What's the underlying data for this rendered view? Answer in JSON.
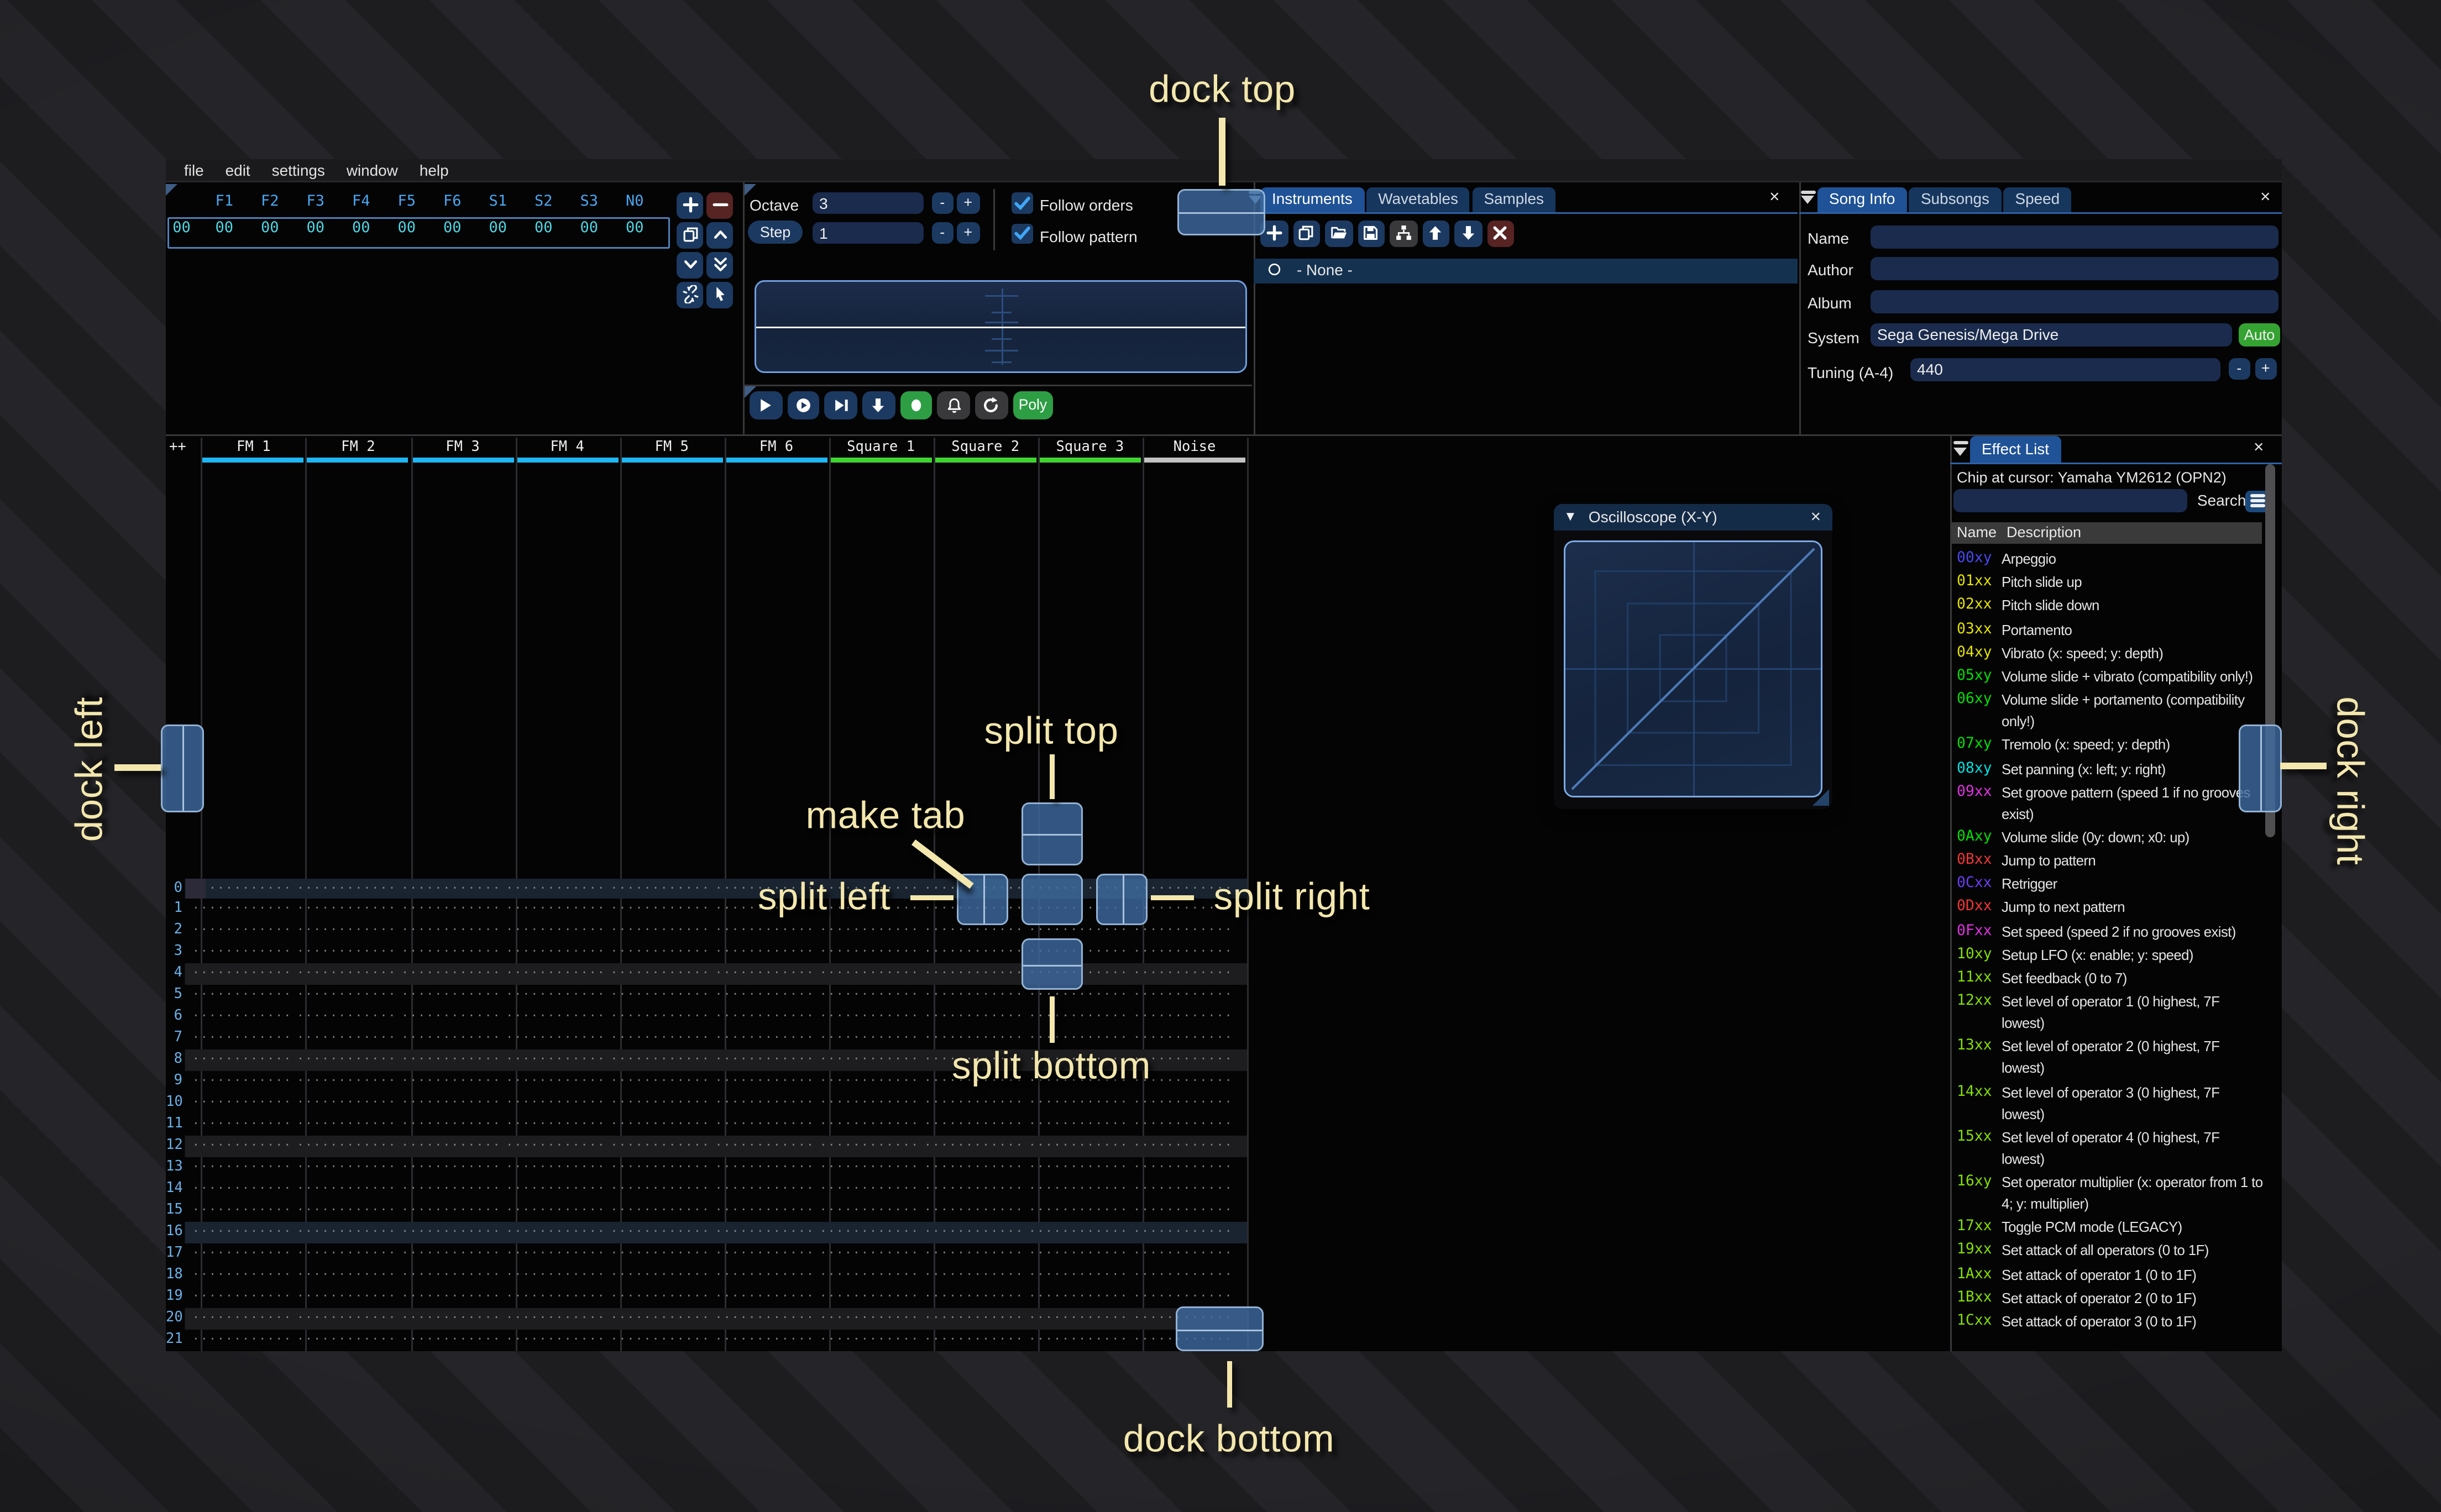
{
  "menu": {
    "items": [
      "file",
      "edit",
      "settings",
      "window",
      "help"
    ]
  },
  "orders": {
    "row_index": "00",
    "channels": [
      "F1",
      "F2",
      "F3",
      "F4",
      "F5",
      "F6",
      "S1",
      "S2",
      "S3",
      "N0"
    ],
    "row_values": [
      "00",
      "00",
      "00",
      "00",
      "00",
      "00",
      "00",
      "00",
      "00",
      "00"
    ],
    "buttons": [
      {
        "name": "add-order-button",
        "icon": "plus-icon",
        "variant": "blue"
      },
      {
        "name": "remove-order-button",
        "icon": "minus-icon",
        "variant": "red"
      },
      {
        "name": "duplicate-order-button",
        "icon": "duplicate-icon",
        "variant": "blue"
      },
      {
        "name": "move-order-up-button",
        "icon": "chevron-up-icon",
        "variant": "blue"
      },
      {
        "name": "move-order-down-button",
        "icon": "chevron-down-icon",
        "variant": "blue"
      },
      {
        "name": "duplicate-order-end-button",
        "icon": "double-chevron-down-icon",
        "variant": "blue"
      },
      {
        "name": "order-change-mode-button",
        "icon": "broken-link-icon",
        "variant": "blue"
      },
      {
        "name": "order-edit-mode-button",
        "icon": "pointer-icon",
        "variant": "blue"
      }
    ]
  },
  "play_controls": {
    "octave_label": "Octave",
    "octave_value": "3",
    "step_label": "Step",
    "step_value": "1",
    "decrement_label": "-",
    "increment_label": "+",
    "follow_orders": {
      "label": "Follow orders",
      "checked": true
    },
    "follow_pattern": {
      "label": "Follow pattern",
      "checked": true
    },
    "transport": [
      {
        "name": "play-button",
        "icon": "play-icon",
        "variant": "blue"
      },
      {
        "name": "play-pattern-button",
        "icon": "play-circle-icon",
        "variant": "blue"
      },
      {
        "name": "play-row-button",
        "icon": "play-row-icon",
        "variant": "blue"
      },
      {
        "name": "step-row-button",
        "icon": "arrow-down-icon",
        "variant": "blue"
      },
      {
        "name": "edit-record-button",
        "icon": "record-icon",
        "variant": "green"
      },
      {
        "name": "metronome-button",
        "icon": "bell-icon",
        "variant": "gray"
      },
      {
        "name": "repeat-pattern-button",
        "icon": "repeat-icon",
        "variant": "gray"
      },
      {
        "name": "poly-button",
        "label": "Poly",
        "variant": "green poly"
      }
    ]
  },
  "instruments_panel": {
    "tabs": [
      "Instruments",
      "Wavetables",
      "Samples"
    ],
    "active_tab": "Instruments",
    "close_label": "×",
    "toolbar": [
      {
        "name": "add-instrument-button",
        "icon": "plus-icon",
        "variant": "blue"
      },
      {
        "name": "duplicate-instrument-button",
        "icon": "duplicate-icon",
        "variant": "blue"
      },
      {
        "name": "open-instrument-button",
        "icon": "folder-open-icon",
        "variant": "blue"
      },
      {
        "name": "save-instrument-button",
        "icon": "floppy-icon",
        "variant": "blue"
      },
      {
        "name": "instrument-folders-button",
        "icon": "tree-icon",
        "variant": "gray"
      },
      {
        "name": "move-instrument-up-button",
        "icon": "arrow-up-icon",
        "variant": "blue"
      },
      {
        "name": "move-instrument-down-button",
        "icon": "arrow-down-icon",
        "variant": "blue"
      },
      {
        "name": "delete-instrument-button",
        "icon": "delete-x-icon",
        "variant": "red"
      }
    ],
    "list": [
      {
        "icon": "circle-icon",
        "label": "- None -",
        "selected": true
      }
    ]
  },
  "song_info_panel": {
    "tabs": [
      "Song Info",
      "Subsongs",
      "Speed"
    ],
    "active_tab": "Song Info",
    "close_label": "×",
    "fields": [
      {
        "label": "Name",
        "value": ""
      },
      {
        "label": "Author",
        "value": ""
      },
      {
        "label": "Album",
        "value": ""
      }
    ],
    "system_label": "System",
    "system_value": "Sega Genesis/Mega Drive",
    "auto_label": "Auto",
    "tuning_label": "Tuning (A-4)",
    "tuning_value": "440",
    "decrement_label": "-",
    "increment_label": "+"
  },
  "pattern": {
    "corner_label": "++",
    "channels": [
      {
        "name": "FM 1",
        "underline_color": "#1fb6f3"
      },
      {
        "name": "FM 2",
        "underline_color": "#1fb6f3"
      },
      {
        "name": "FM 3",
        "underline_color": "#1fb6f3"
      },
      {
        "name": "FM 4",
        "underline_color": "#1fb6f3"
      },
      {
        "name": "FM 5",
        "underline_color": "#1fb6f3"
      },
      {
        "name": "FM 6",
        "underline_color": "#1fb6f3"
      },
      {
        "name": "Square 1",
        "underline_color": "#3fd430"
      },
      {
        "name": "Square 2",
        "underline_color": "#3fd430"
      },
      {
        "name": "Square 3",
        "underline_color": "#3fd430"
      },
      {
        "name": "Noise",
        "underline_color": "#c2c2c2"
      }
    ],
    "row_labels": [
      "0",
      "1",
      "2",
      "3",
      "4",
      "5",
      "6",
      "7",
      "8",
      "9",
      "10",
      "11",
      "12",
      "13",
      "14",
      "15",
      "16",
      "17",
      "18",
      "19",
      "20",
      "21"
    ],
    "empty_cell": "·············",
    "cursor": {
      "row": 0,
      "channel": "FM 1"
    }
  },
  "effect_list_panel": {
    "title": "Effect List",
    "close_label": "×",
    "chip_at_cursor": "Chip at cursor: Yamaha YM2612 (OPN2)",
    "search_value": "",
    "search_label": "Search",
    "columns": [
      "Name",
      "Description"
    ],
    "rows": [
      {
        "code": "00xy",
        "color": "#4848f0",
        "desc": "Arpeggio"
      },
      {
        "code": "01xx",
        "color": "#e3e300",
        "desc": "Pitch slide up"
      },
      {
        "code": "02xx",
        "color": "#e3e300",
        "desc": "Pitch slide down"
      },
      {
        "code": "03xx",
        "color": "#e3e300",
        "desc": "Portamento"
      },
      {
        "code": "04xy",
        "color": "#e3e300",
        "desc": "Vibrato (x: speed; y: depth)"
      },
      {
        "code": "05xy",
        "color": "#00e000",
        "desc": "Volume slide + vibrato (compatibility only!)"
      },
      {
        "code": "06xy",
        "color": "#00e000",
        "desc": "Volume slide + portamento (compatibility only!)"
      },
      {
        "code": "07xy",
        "color": "#00e000",
        "desc": "Tremolo (x: speed; y: depth)"
      },
      {
        "code": "08xy",
        "color": "#00e2e2",
        "desc": "Set panning (x: left; y: right)"
      },
      {
        "code": "09xx",
        "color": "#e032e0",
        "desc": "Set groove pattern (speed 1 if no grooves exist)"
      },
      {
        "code": "0Axy",
        "color": "#00e000",
        "desc": "Volume slide (0y: down; x0: up)"
      },
      {
        "code": "0Bxx",
        "color": "#f23535",
        "desc": "Jump to pattern"
      },
      {
        "code": "0Cxx",
        "color": "#6a3df2",
        "desc": "Retrigger"
      },
      {
        "code": "0Dxx",
        "color": "#f23535",
        "desc": "Jump to next pattern"
      },
      {
        "code": "0Fxx",
        "color": "#e032e0",
        "desc": "Set speed (speed 2 if no grooves exist)"
      },
      {
        "code": "10xy",
        "color": "#84e000",
        "desc": "Setup LFO (x: enable; y: speed)"
      },
      {
        "code": "11xx",
        "color": "#84e000",
        "desc": "Set feedback (0 to 7)"
      },
      {
        "code": "12xx",
        "color": "#84e000",
        "desc": "Set level of operator 1 (0 highest, 7F lowest)"
      },
      {
        "code": "13xx",
        "color": "#84e000",
        "desc": "Set level of operator 2 (0 highest, 7F lowest)"
      },
      {
        "code": "14xx",
        "color": "#84e000",
        "desc": "Set level of operator 3 (0 highest, 7F lowest)"
      },
      {
        "code": "15xx",
        "color": "#84e000",
        "desc": "Set level of operator 4 (0 highest, 7F lowest)"
      },
      {
        "code": "16xy",
        "color": "#84e000",
        "desc": "Set operator multiplier (x: operator from 1 to 4; y: multiplier)"
      },
      {
        "code": "17xx",
        "color": "#84e000",
        "desc": "Toggle PCM mode (LEGACY)"
      },
      {
        "code": "19xx",
        "color": "#84e000",
        "desc": "Set attack of all operators (0 to 1F)"
      },
      {
        "code": "1Axx",
        "color": "#84e000",
        "desc": "Set attack of operator 1 (0 to 1F)"
      },
      {
        "code": "1Bxx",
        "color": "#84e000",
        "desc": "Set attack of operator 2 (0 to 1F)"
      },
      {
        "code": "1Cxx",
        "color": "#84e000",
        "desc": "Set attack of operator 3 (0 to 1F)"
      }
    ]
  },
  "oscilloscope_window": {
    "title": "Oscilloscope (X-Y)",
    "close_label": "×",
    "collapse_icon": "▼"
  },
  "dock_overlay": {
    "label_color": "#f3e7ad",
    "labels": {
      "dock_top": "dock top",
      "dock_left": "dock left",
      "dock_right": "dock right",
      "dock_bottom": "dock bottom",
      "split_top": "split top",
      "split_left": "split left",
      "split_right": "split right",
      "split_bottom": "split bottom",
      "make_tab": "make tab"
    }
  }
}
